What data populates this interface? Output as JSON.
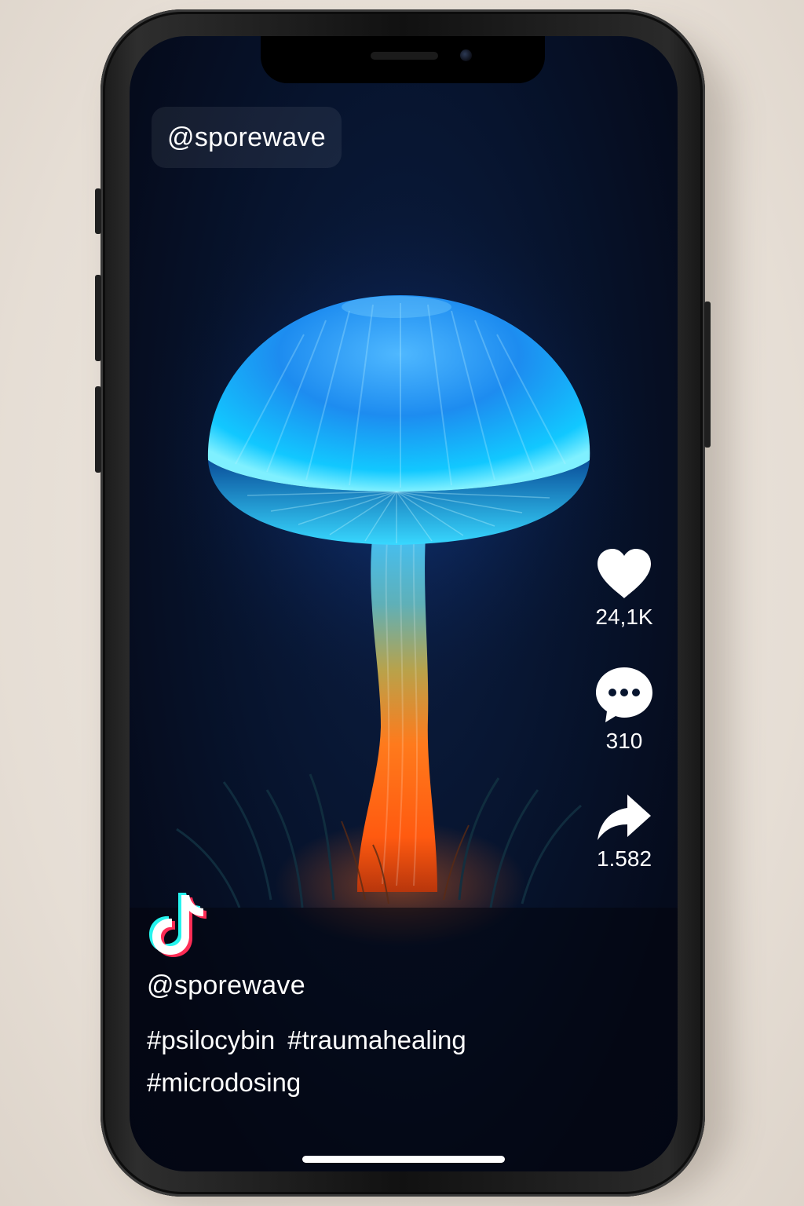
{
  "post": {
    "top_username": "@sporewave",
    "username": "@sporewave",
    "hashtags": [
      "#psilocybin",
      "#traumahealing",
      "#microdosing"
    ]
  },
  "actions": {
    "likes": "24,1K",
    "comments": "310",
    "shares": "1.582"
  },
  "icons": {
    "like": "heart-icon",
    "comment": "comment-bubble-icon",
    "share": "share-arrow-icon",
    "brand": "tiktok-logo-icon"
  },
  "colors": {
    "screen_bg": "#050b1c",
    "mushroom_cap": "#1ea0ff",
    "mushroom_stem_bottom": "#ff5a10",
    "text": "#ffffff",
    "brand_cyan": "#25f4ee",
    "brand_red": "#fe2c55"
  }
}
